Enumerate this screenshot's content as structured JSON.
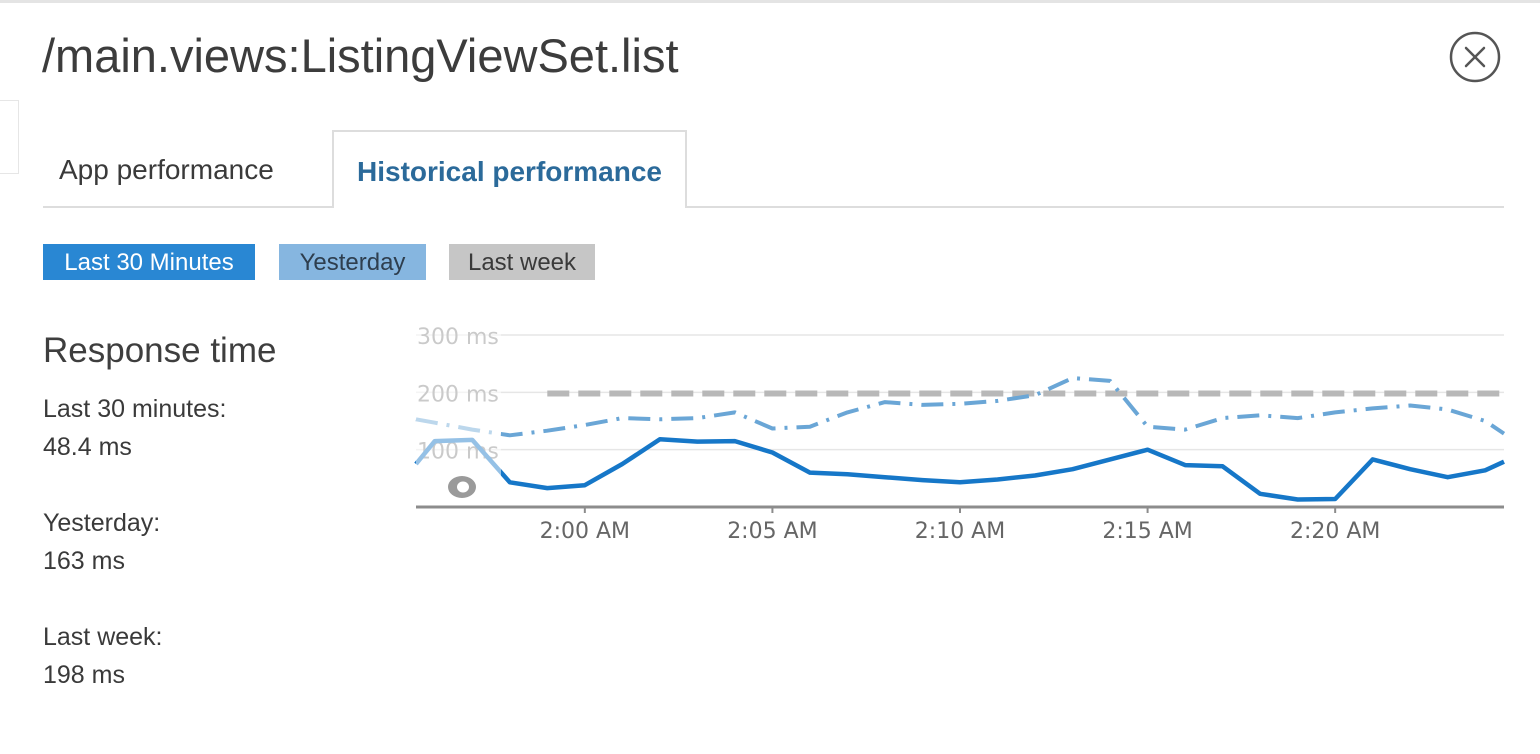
{
  "window": {
    "title": "/main.views:ListingViewSet.list"
  },
  "tabs": [
    {
      "label": "App performance",
      "active": false
    },
    {
      "label": "Historical performance",
      "active": true
    }
  ],
  "periods": {
    "last30": "Last 30 Minutes",
    "yesterday": "Yesterday",
    "lastweek": "Last week"
  },
  "summary": {
    "heading": "Response time",
    "last30_label": "Last 30 minutes:",
    "last30_value": "48.4 ms",
    "yesterday_label": "Yesterday:",
    "yesterday_value": "163 ms",
    "lastweek_label": "Last week:",
    "lastweek_value": "198 ms"
  },
  "colors": {
    "last30": "#1677c8",
    "yesterday": "#6aa6d6",
    "lastweek": "#b8b8b8",
    "active_tab": "#2b6a9a"
  },
  "icons": {
    "close": "close-circle-icon",
    "marker": "ring-marker-icon"
  },
  "chart_data": {
    "type": "line",
    "x_unit": "minutes",
    "xlim": [
      "1:55:30 AM",
      "2:24:30 AM"
    ],
    "ylim": [
      0,
      300
    ],
    "y_ticks": [
      {
        "value": 100,
        "label": "100 ms"
      },
      {
        "value": 200,
        "label": "200 ms"
      },
      {
        "value": 300,
        "label": "300 ms"
      }
    ],
    "x_ticks": [
      {
        "value": "2:00 AM",
        "label": "2:00 AM"
      },
      {
        "value": "2:05 AM",
        "label": "2:05 AM"
      },
      {
        "value": "2:10 AM",
        "label": "2:10 AM"
      },
      {
        "value": "2:15 AM",
        "label": "2:15 AM"
      },
      {
        "value": "2:20 AM",
        "label": "2:20 AM"
      }
    ],
    "grid": true,
    "series": [
      {
        "key": "last30",
        "style": "solid",
        "points": [
          {
            "x": "1:55:30 AM",
            "y": 75
          },
          {
            "x": "1:56:00 AM",
            "y": 115
          },
          {
            "x": "1:57:00 AM",
            "y": 117
          },
          {
            "x": "1:58:00 AM",
            "y": 43
          },
          {
            "x": "1:59:00 AM",
            "y": 33
          },
          {
            "x": "2:00:00 AM",
            "y": 38
          },
          {
            "x": "2:01:00 AM",
            "y": 75
          },
          {
            "x": "2:02:00 AM",
            "y": 118
          },
          {
            "x": "2:03:00 AM",
            "y": 114
          },
          {
            "x": "2:04:00 AM",
            "y": 115
          },
          {
            "x": "2:05:00 AM",
            "y": 95
          },
          {
            "x": "2:06:00 AM",
            "y": 60
          },
          {
            "x": "2:07:00 AM",
            "y": 57
          },
          {
            "x": "2:08:00 AM",
            "y": 52
          },
          {
            "x": "2:09:00 AM",
            "y": 47
          },
          {
            "x": "2:10:00 AM",
            "y": 43
          },
          {
            "x": "2:11:00 AM",
            "y": 48
          },
          {
            "x": "2:12:00 AM",
            "y": 55
          },
          {
            "x": "2:13:00 AM",
            "y": 66
          },
          {
            "x": "2:14:00 AM",
            "y": 83
          },
          {
            "x": "2:15:00 AM",
            "y": 100
          },
          {
            "x": "2:16:00 AM",
            "y": 73
          },
          {
            "x": "2:17:00 AM",
            "y": 71
          },
          {
            "x": "2:18:00 AM",
            "y": 23
          },
          {
            "x": "2:19:00 AM",
            "y": 13
          },
          {
            "x": "2:20:00 AM",
            "y": 14
          },
          {
            "x": "2:21:00 AM",
            "y": 83
          },
          {
            "x": "2:22:00 AM",
            "y": 66
          },
          {
            "x": "2:23:00 AM",
            "y": 52
          },
          {
            "x": "2:24:00 AM",
            "y": 64
          },
          {
            "x": "2:24:30 AM",
            "y": 79
          }
        ]
      },
      {
        "key": "yesterday",
        "style": "dashed",
        "points": [
          {
            "x": "1:55:30 AM",
            "y": 153
          },
          {
            "x": "1:56:00 AM",
            "y": 147
          },
          {
            "x": "1:57:00 AM",
            "y": 135
          },
          {
            "x": "1:58:00 AM",
            "y": 125
          },
          {
            "x": "1:59:00 AM",
            "y": 133
          },
          {
            "x": "2:00:00 AM",
            "y": 143
          },
          {
            "x": "2:01:00 AM",
            "y": 155
          },
          {
            "x": "2:02:00 AM",
            "y": 153
          },
          {
            "x": "2:03:00 AM",
            "y": 155
          },
          {
            "x": "2:04:00 AM",
            "y": 165
          },
          {
            "x": "2:05:00 AM",
            "y": 137
          },
          {
            "x": "2:06:00 AM",
            "y": 140
          },
          {
            "x": "2:07:00 AM",
            "y": 165
          },
          {
            "x": "2:08:00 AM",
            "y": 183
          },
          {
            "x": "2:09:00 AM",
            "y": 178
          },
          {
            "x": "2:10:00 AM",
            "y": 180
          },
          {
            "x": "2:11:00 AM",
            "y": 185
          },
          {
            "x": "2:12:00 AM",
            "y": 195
          },
          {
            "x": "2:13:00 AM",
            "y": 225
          },
          {
            "x": "2:14:00 AM",
            "y": 220
          },
          {
            "x": "2:15:00 AM",
            "y": 140
          },
          {
            "x": "2:16:00 AM",
            "y": 135
          },
          {
            "x": "2:17:00 AM",
            "y": 155
          },
          {
            "x": "2:18:00 AM",
            "y": 160
          },
          {
            "x": "2:19:00 AM",
            "y": 155
          },
          {
            "x": "2:20:00 AM",
            "y": 165
          },
          {
            "x": "2:21:00 AM",
            "y": 172
          },
          {
            "x": "2:22:00 AM",
            "y": 177
          },
          {
            "x": "2:23:00 AM",
            "y": 170
          },
          {
            "x": "2:24:00 AM",
            "y": 150
          },
          {
            "x": "2:24:30 AM",
            "y": 128
          }
        ]
      },
      {
        "key": "lastweek",
        "style": "long-dash",
        "points": [
          {
            "x": "1:59:00 AM",
            "y": 198
          },
          {
            "x": "2:24:30 AM",
            "y": 198
          }
        ]
      }
    ]
  }
}
